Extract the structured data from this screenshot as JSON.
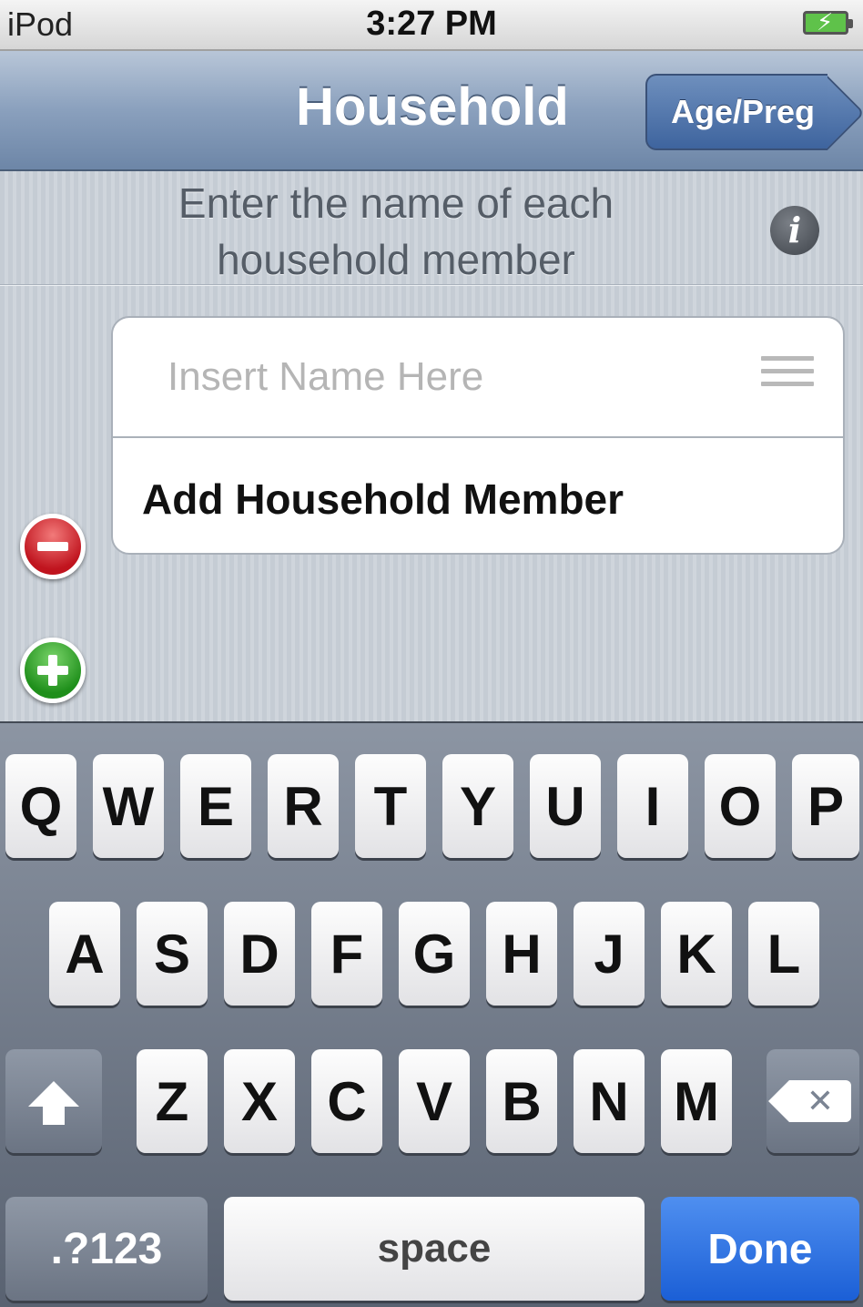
{
  "status_bar": {
    "carrier": "iPod",
    "time": "3:27 PM",
    "battery_icon": "battery-charging-icon"
  },
  "nav_bar": {
    "title": "Household",
    "forward_button": "Age/Preg"
  },
  "content": {
    "instructions": "Enter the name of each household member",
    "info_icon": "info-icon",
    "name_field": {
      "value": "",
      "placeholder": "Insert Name Here"
    },
    "add_label": "Add Household Member",
    "delete_icon": "minus-circle-icon",
    "add_icon": "plus-circle-icon",
    "reorder_icon": "reorder-grip-icon"
  },
  "keyboard": {
    "row1": [
      "Q",
      "W",
      "E",
      "R",
      "T",
      "Y",
      "U",
      "I",
      "O",
      "P"
    ],
    "row2": [
      "A",
      "S",
      "D",
      "F",
      "G",
      "H",
      "J",
      "K",
      "L"
    ],
    "row3": [
      "Z",
      "X",
      "C",
      "V",
      "B",
      "N",
      "M"
    ],
    "shift_icon": "shift-arrow-icon",
    "backspace_icon": "backspace-icon",
    "backspace_glyph": "✕",
    "numbers_label": ".?123",
    "space_label": "space",
    "done_label": "Done"
  },
  "colors": {
    "nav_tint": "#6d86a7",
    "done_blue": "#1b5fd6",
    "delete_red": "#c0141e",
    "add_green": "#1f8f1b"
  }
}
